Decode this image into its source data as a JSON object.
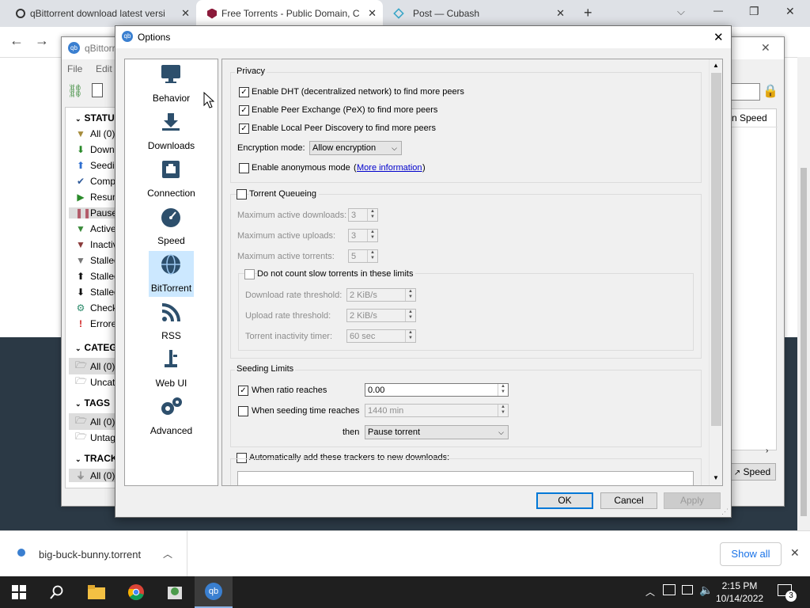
{
  "browser": {
    "tabs": [
      {
        "title": "qBittorrent download latest versi",
        "active": false
      },
      {
        "title": "Free Torrents - Public Domain, C",
        "active": true
      },
      {
        "title": "Post — Cubash",
        "active": false
      }
    ],
    "new_tab": "+",
    "controls": {
      "dropdown": "⌵",
      "minimize": "—",
      "restore": "❐",
      "close": "✕"
    }
  },
  "qbt_window": {
    "title": "qBittorrent",
    "menu": [
      "File",
      "Edit"
    ],
    "status_header": "STATUS",
    "status_items": [
      {
        "icon": "filter-icon",
        "glyph": "▼",
        "color": "#a68c3c",
        "label": "All (0)"
      },
      {
        "icon": "download-arrow-icon",
        "glyph": "⬇",
        "color": "#2a8a2a",
        "label": "Downlo"
      },
      {
        "icon": "upload-arrow-icon",
        "glyph": "⬆",
        "color": "#2f6fd0",
        "label": "Seedin"
      },
      {
        "icon": "check-icon",
        "glyph": "✔",
        "color": "#2f5a9a",
        "label": "Compl"
      },
      {
        "icon": "play-icon",
        "glyph": "▶",
        "color": "#2a8a2a",
        "label": "Resum"
      },
      {
        "icon": "pause-icon",
        "glyph": "❚❚",
        "color": "#b35c6a",
        "label": "Paused"
      },
      {
        "icon": "filter-icon",
        "glyph": "▼",
        "color": "#3a8a3a",
        "label": "Active"
      },
      {
        "icon": "filter-icon",
        "glyph": "▼",
        "color": "#8a3a3a",
        "label": "Inactiv"
      },
      {
        "icon": "filter-icon",
        "glyph": "▼",
        "color": "#777777",
        "label": "Stalled"
      },
      {
        "icon": "upload-arrow-icon",
        "glyph": "⬆",
        "color": "#111111",
        "label": "Stalled"
      },
      {
        "icon": "download-arrow-icon",
        "glyph": "⬇",
        "color": "#111111",
        "label": "Stalled"
      },
      {
        "icon": "gear-icon",
        "glyph": "⚙",
        "color": "#2a8a6a",
        "label": "Checki"
      },
      {
        "icon": "error-icon",
        "glyph": "!",
        "color": "#d02020",
        "label": "Errored"
      }
    ],
    "categories_header": "CATEGO",
    "category_items": [
      {
        "label": "All (0)"
      },
      {
        "label": "Uncate"
      }
    ],
    "tags_header": "TAGS",
    "tag_items": [
      {
        "label": "All (0)"
      },
      {
        "label": "Untag"
      }
    ],
    "trackers_header": "TRACKE",
    "tracker_items": [
      {
        "label": "All (0)"
      }
    ],
    "column_fragment": "n Speed",
    "speed_button": "Speed"
  },
  "options": {
    "title": "Options",
    "close": "✕",
    "nav": [
      {
        "label": "Behavior",
        "icon": "monitor-icon",
        "selected": false
      },
      {
        "label": "Downloads",
        "icon": "download-icon",
        "selected": false
      },
      {
        "label": "Connection",
        "icon": "network-icon",
        "selected": false
      },
      {
        "label": "Speed",
        "icon": "speedometer-icon",
        "selected": false
      },
      {
        "label": "BitTorrent",
        "icon": "globe-icon",
        "selected": true
      },
      {
        "label": "RSS",
        "icon": "rss-icon",
        "selected": false
      },
      {
        "label": "Web UI",
        "icon": "lamp-icon",
        "selected": false
      },
      {
        "label": "Advanced",
        "icon": "gears-icon",
        "selected": false
      }
    ],
    "privacy": {
      "title": "Privacy",
      "dht": {
        "label": "Enable DHT (decentralized network) to find more peers",
        "checked": true
      },
      "pex": {
        "label": "Enable Peer Exchange (PeX) to find more peers",
        "checked": true
      },
      "lpd": {
        "label": "Enable Local Peer Discovery to find more peers",
        "checked": true
      },
      "encryption_label": "Encryption mode:",
      "encryption_value": "Allow encryption",
      "anon": {
        "label": "Enable anonymous mode",
        "checked": false
      },
      "more_info_open": "(",
      "more_info": "More information",
      "more_info_close": ")"
    },
    "queueing": {
      "title": "Torrent Queueing",
      "checked": false,
      "max_downloads_label": "Maximum active downloads:",
      "max_downloads": "3",
      "max_uploads_label": "Maximum active uploads:",
      "max_uploads": "3",
      "max_torrents_label": "Maximum active torrents:",
      "max_torrents": "5",
      "slow": {
        "label": "Do not count slow torrents in these limits",
        "checked": false,
        "dl_threshold_label": "Download rate threshold:",
        "dl_threshold": "2 KiB/s",
        "ul_threshold_label": "Upload rate threshold:",
        "ul_threshold": "2 KiB/s",
        "inactivity_label": "Torrent inactivity timer:",
        "inactivity": "60 sec"
      }
    },
    "seeding": {
      "title": "Seeding Limits",
      "ratio": {
        "label": "When ratio reaches",
        "checked": true,
        "value": "0.00"
      },
      "time": {
        "label": "When seeding time reaches",
        "checked": false,
        "value": "1440 min"
      },
      "then_label": "then",
      "then_value": "Pause torrent"
    },
    "trackers": {
      "label": "Automatically add these trackers to new downloads:",
      "checked": false
    },
    "buttons": {
      "ok": "OK",
      "cancel": "Cancel",
      "apply": "Apply"
    }
  },
  "download_bar": {
    "file": "big-buck-bunny.torrent",
    "show_all": "Show all",
    "close": "✕"
  },
  "taskbar": {
    "time": "2:15 PM",
    "date": "10/14/2022",
    "notifications": "3"
  }
}
